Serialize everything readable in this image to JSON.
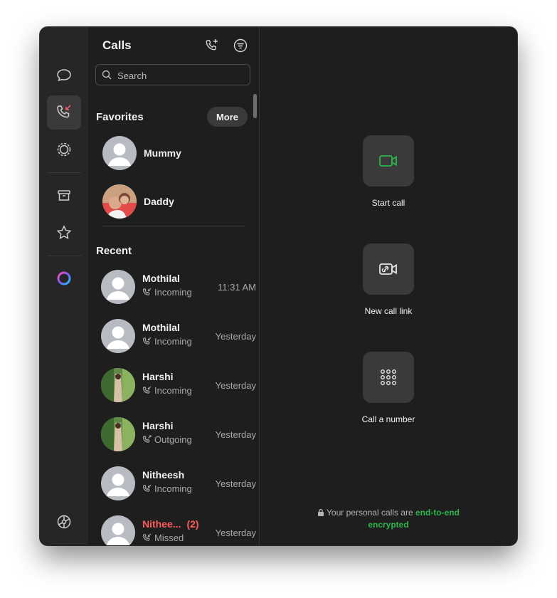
{
  "window": {
    "title": "Calls"
  },
  "colors": {
    "accent_green": "#2bb64b",
    "missed_red": "#ff5d5d",
    "badge_red": "#e74c5a"
  },
  "rail": {
    "items": [
      {
        "icon": "chats-icon"
      },
      {
        "icon": "calls-icon",
        "active": true
      },
      {
        "icon": "updates-icon"
      },
      {
        "icon": "archive-icon"
      },
      {
        "icon": "starred-icon"
      },
      {
        "icon": "meta-ai-icon"
      },
      {
        "icon": "settings-icon"
      }
    ]
  },
  "header": {
    "title": "Calls"
  },
  "search": {
    "placeholder": "Search"
  },
  "favorites": {
    "label": "Favorites",
    "more_label": "More",
    "items": [
      {
        "name": "Mummy"
      },
      {
        "name": "Daddy"
      }
    ]
  },
  "recent": {
    "label": "Recent",
    "items": [
      {
        "name": "Mothilal",
        "type": "Incoming",
        "time": "11:31 AM"
      },
      {
        "name": "Mothilal",
        "type": "Incoming",
        "time": "Yesterday"
      },
      {
        "name": "Harshi",
        "type": "Incoming",
        "time": "Yesterday"
      },
      {
        "name": "Harshi",
        "type": "Outgoing",
        "time": "Yesterday"
      },
      {
        "name": "Nitheesh",
        "type": "Incoming",
        "time": "Yesterday"
      },
      {
        "name": "Nithee...",
        "count": "(2)",
        "type": "Missed",
        "time": "Yesterday"
      }
    ]
  },
  "actions": {
    "start_call": "Start call",
    "new_call_link": "New call link",
    "call_number": "Call a number"
  },
  "footer": {
    "prefix": "Your personal calls are ",
    "highlight1": "end-to-end",
    "highlight2": "encrypted"
  }
}
